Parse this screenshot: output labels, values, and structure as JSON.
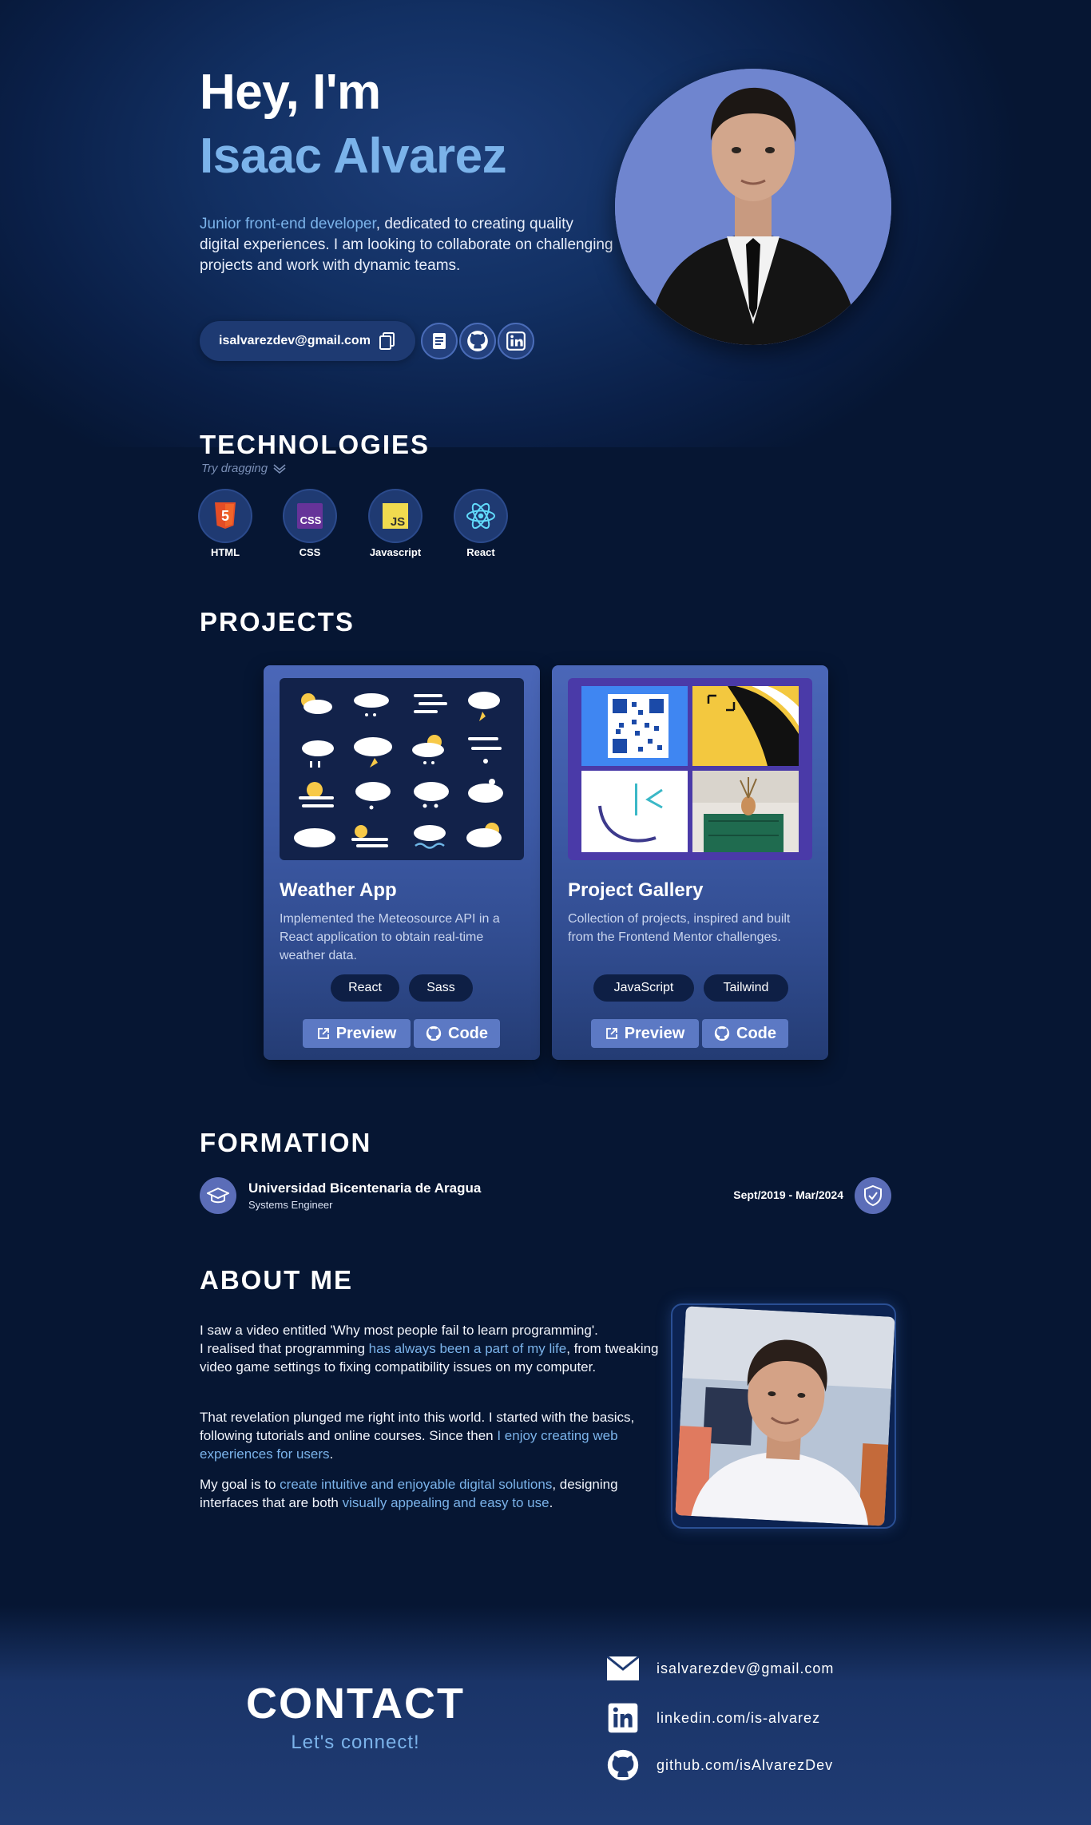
{
  "hero": {
    "greeting": "Hey, I'm",
    "name": "Isaac Alvarez",
    "desc_highlight": "Junior front-end developer",
    "desc_rest": ", dedicated to creating quality digital experiences. I am looking to collaborate on challenging projects and work with dynamic teams.",
    "email": "isalvarezdev@gmail.com",
    "icons": [
      "copy-icon",
      "resume-icon",
      "github-icon",
      "linkedin-icon"
    ]
  },
  "technologies": {
    "title": "TECHNOLOGIES",
    "hint": "Try dragging",
    "items": [
      {
        "label": "HTML",
        "icon": "html5-icon",
        "color": "#e44d26"
      },
      {
        "label": "CSS",
        "icon": "css-icon",
        "color": "#663399"
      },
      {
        "label": "Javascript",
        "icon": "javascript-icon",
        "color": "#f0db4f"
      },
      {
        "label": "React",
        "icon": "react-icon",
        "color": "#61dafb"
      }
    ]
  },
  "projects": {
    "title": "PROJECTS",
    "items": [
      {
        "title": "Weather App",
        "desc": "Implemented the Meteosource API in a React application to obtain real-time weather data.",
        "tags": [
          "React",
          "Sass"
        ],
        "preview": "Preview",
        "code": "Code"
      },
      {
        "title": "Project Gallery",
        "desc": "Collection of projects, inspired and built from the Frontend Mentor challenges.",
        "tags": [
          "JavaScript",
          "Tailwind"
        ],
        "preview": "Preview",
        "code": "Code"
      }
    ]
  },
  "formation": {
    "title": "FORMATION",
    "university": "Universidad Bicentenaria de Aragua",
    "degree": "Systems Engineer",
    "dates": "Sept/2019 - Mar/2024"
  },
  "about": {
    "title": "ABOUT ME",
    "p1_a": "I saw a video entitled 'Why most people fail to learn programming'.",
    "p1_b": "I realised that programming ",
    "p1_hl": "has always been a part of my life",
    "p1_c": ", from tweaking video game settings to fixing compatibility issues on my computer.",
    "p2_a": "That revelation plunged me right into this world. I started with the basics, following tutorials and online courses. Since then ",
    "p2_hl": "I enjoy creating web experiences for users",
    "p2_b": ".",
    "p3_a": "My goal is to ",
    "p3_hl1": "create intuitive and enjoyable digital solutions",
    "p3_b": ", designing interfaces that are both ",
    "p3_hl2": "visually appealing and easy to use",
    "p3_c": "."
  },
  "contact": {
    "title": "CONTACT",
    "subtitle": "Let's connect!",
    "email": "isalvarezdev@gmail.com",
    "linkedin": "linkedin.com/is-alvarez",
    "github": "github.com/isAlvarezDev"
  },
  "colors": {
    "accent": "#7bb3ea",
    "background": "#061633",
    "card": "#3d5aa6"
  }
}
